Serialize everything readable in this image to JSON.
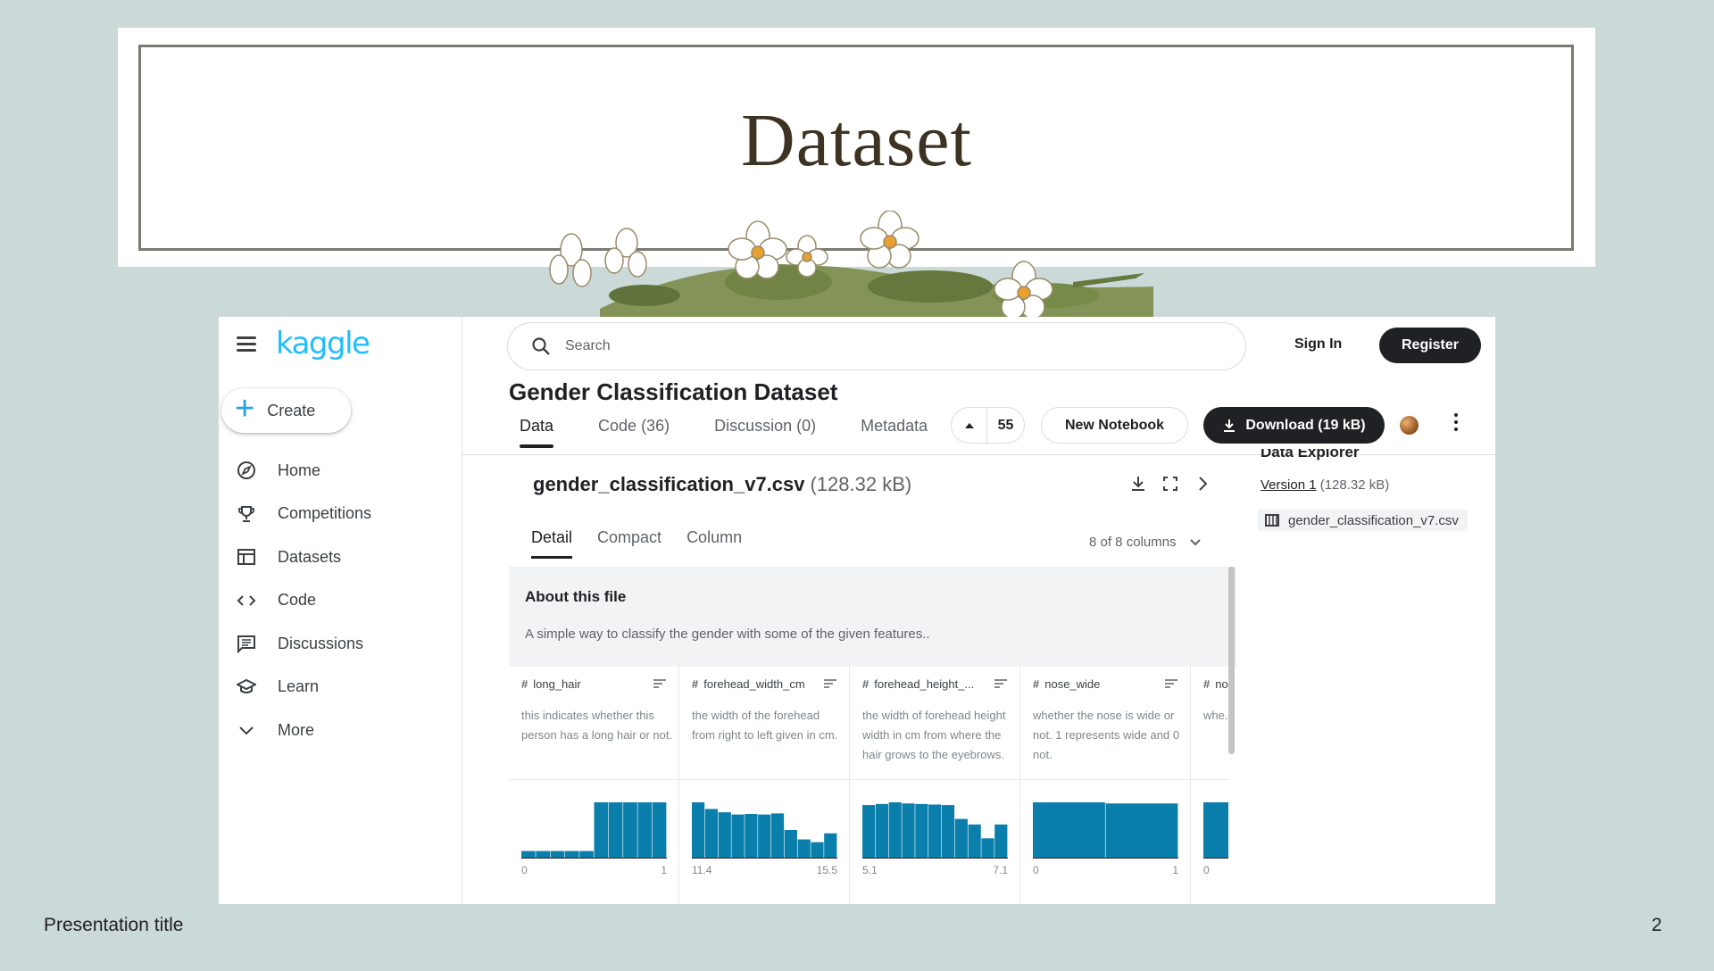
{
  "slide": {
    "title": "Dataset",
    "footer_left": "Presentation title",
    "page_number": "2"
  },
  "app": {
    "logo": "kaggle",
    "create_label": "Create",
    "nav": [
      {
        "label": "Home",
        "icon": "compass-icon"
      },
      {
        "label": "Competitions",
        "icon": "trophy-icon"
      },
      {
        "label": "Datasets",
        "icon": "table-icon"
      },
      {
        "label": "Code",
        "icon": "code-icon"
      },
      {
        "label": "Discussions",
        "icon": "discussion-icon"
      },
      {
        "label": "Learn",
        "icon": "graduation-cap-icon"
      },
      {
        "label": "More",
        "icon": "chevron-down-icon"
      }
    ],
    "search_placeholder": "Search",
    "signin": "Sign In",
    "register": "Register"
  },
  "dataset": {
    "title": "Gender Classification Dataset",
    "tabs": [
      "Data",
      "Code (36)",
      "Discussion (0)",
      "Metadata"
    ],
    "active_tab": 0,
    "votes": "55",
    "new_notebook": "New Notebook",
    "download": "Download (19 kB)"
  },
  "file": {
    "name": "gender_classification_v7.csv",
    "size": "(128.32 kB)",
    "subtabs": [
      "Detail",
      "Compact",
      "Column"
    ],
    "column_count": "8 of 8 columns",
    "about_title": "About this file",
    "about_text": "A simple way to classify the gender with some of the given features..",
    "columns": [
      {
        "name": "long_hair",
        "description": "this indicates whether this person has a long hair or not.",
        "min": "0",
        "max": "1",
        "hist": [
          0.12,
          0.12,
          0.12,
          0.12,
          0.12,
          1.0,
          1.0,
          1.0,
          1.0,
          1.0
        ]
      },
      {
        "name": "forehead_width_cm",
        "description": "the width of the forehead from right to left given in cm.",
        "min": "11.4",
        "max": "15.5",
        "hist": [
          1.0,
          0.88,
          0.82,
          0.78,
          0.79,
          0.78,
          0.8,
          0.5,
          0.33,
          0.28,
          0.44
        ]
      },
      {
        "name": "forehead_height_...",
        "description": "the width of forehead height width in cm from where the hair grows to the eyebrows.",
        "min": "5.1",
        "max": "7.1",
        "hist": [
          0.95,
          0.97,
          1.0,
          0.98,
          0.97,
          0.96,
          0.95,
          0.7,
          0.6,
          0.35,
          0.6
        ]
      },
      {
        "name": "nose_wide",
        "description": "whether the nose is wide or not. 1 represents wide and 0 not.",
        "min": "0",
        "max": "1",
        "hist": [
          1.0,
          0.98
        ]
      },
      {
        "name": "no...",
        "description": "whe... or no... and...",
        "min": "0",
        "max": "",
        "hist": [
          1.0
        ]
      }
    ]
  },
  "explorer": {
    "title": "Data Explorer",
    "version_link": "Version 1",
    "version_size": "(128.32 kB)",
    "file": "gender_classification_v7.csv"
  },
  "colors": {
    "kaggle_blue": "#20beff",
    "hist_bar": "#0b7fab",
    "slide_bg": "#cbd9d9"
  }
}
